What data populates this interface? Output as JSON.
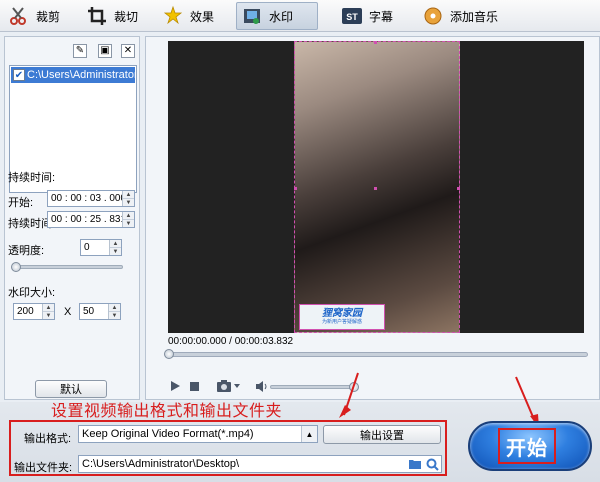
{
  "toolbar": {
    "items": [
      {
        "label": "裁剪",
        "icon": "scissors-icon"
      },
      {
        "label": "裁切",
        "icon": "crop-icon"
      },
      {
        "label": "效果",
        "icon": "effects-stars-icon"
      },
      {
        "label": "水印",
        "icon": "watermark-icon",
        "active": true
      },
      {
        "label": "字幕",
        "icon": "subtitle-st-icon"
      },
      {
        "label": "添加音乐",
        "icon": "music-icon"
      }
    ]
  },
  "watermark_panel": {
    "list": [
      {
        "text": "C:\\Users\\Administrator\\",
        "checked": true
      }
    ],
    "duration_label": "持续时间:",
    "start_label": "开始:",
    "start_value": "00 : 00 : 03 . 000",
    "length_label": "持续时间",
    "length_value": "00 : 00 : 25 . 831",
    "opacity_label": "透明度:",
    "opacity_value": "0",
    "opacity_level": 0,
    "size_label": "水印大小:",
    "width_value": "200",
    "x_label": "X",
    "height_value": "50",
    "default_button": "默认"
  },
  "preview": {
    "watermark_title": "狸窝家园",
    "watermark_subtitle": "为新用户答疑解惑",
    "timecode": "00:00:00.000 / 00:00:03.832",
    "progress": 0
  },
  "annotation": {
    "text": "设置视频输出格式和输出文件夹",
    "color": "#d81e1e"
  },
  "output": {
    "format_label": "输出格式:",
    "format_value": "Keep Original Video Format(*.mp4)",
    "settings_button": "输出设置",
    "folder_label": "输出文件夹:",
    "folder_value": "C:\\Users\\Administrator\\Desktop\\"
  },
  "start_button": "开始",
  "colors": {
    "accent": "#3d7bd4",
    "annotation_red": "#d81e1e",
    "watermark_border": "#d04fb0",
    "start_blue": "#2f7fe0"
  }
}
